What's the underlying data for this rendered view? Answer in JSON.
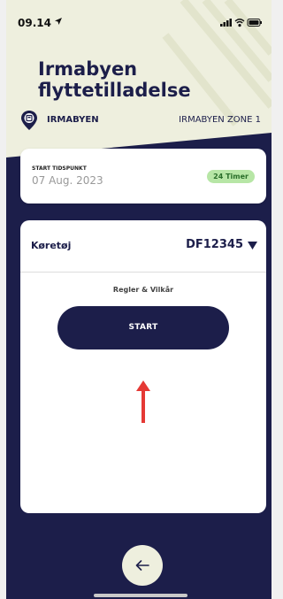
{
  "status_bar": {
    "time": "09.14"
  },
  "page": {
    "title_line1": "Irmabyen",
    "title_line2": "flyttetilladelse"
  },
  "location": {
    "name": "IRMABYEN",
    "zone": "IRMABYEN ZONE 1"
  },
  "start_info": {
    "label": "START TIDSPUNKT",
    "date": "07 Aug. 2023",
    "duration_badge": "24 Timer"
  },
  "vehicle": {
    "label": "Køretøj",
    "plate": "DF12345"
  },
  "terms_link": "Regler & Vilkår",
  "start_button": "START",
  "colors": {
    "navy": "#1c1e4a",
    "cream": "#eeefde",
    "badge_green": "#b7e6a6",
    "annotation_red": "#e53935"
  }
}
